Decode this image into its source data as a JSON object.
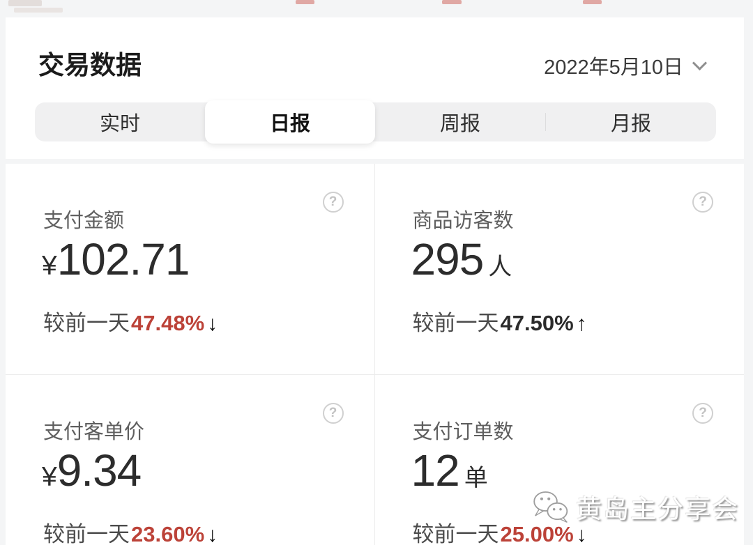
{
  "header": {
    "title": "交易数据",
    "date_label": "2022年5月10日"
  },
  "tabs": [
    {
      "label": "实时",
      "active": false
    },
    {
      "label": "日报",
      "active": true
    },
    {
      "label": "周报",
      "active": false
    },
    {
      "label": "月报",
      "active": false
    }
  ],
  "cards": [
    {
      "label": "支付金额",
      "currency": "¥",
      "value": "102.71",
      "unit": "",
      "delta_prefix": "较前一天",
      "delta_value": "47.48%",
      "delta_arrow": "↓",
      "delta_color": "#bc4238"
    },
    {
      "label": "商品访客数",
      "currency": "",
      "value": "295",
      "unit": "人",
      "delta_prefix": "较前一天",
      "delta_value": "47.50%",
      "delta_arrow": "↑",
      "delta_color": "#2b2b2b"
    },
    {
      "label": "支付客单价",
      "currency": "¥",
      "value": "9.34",
      "unit": "",
      "delta_prefix": "较前一天",
      "delta_value": "23.60%",
      "delta_arrow": "↓",
      "delta_color": "#bc4238"
    },
    {
      "label": "支付订单数",
      "currency": "",
      "value": "12",
      "unit": "单",
      "delta_prefix": "较前一天",
      "delta_value": "25.00%",
      "delta_arrow": "↓",
      "delta_color": "#bc4238"
    }
  ],
  "help_icon_glyph": "?",
  "watermark": {
    "text": "黄岛主分享会",
    "icon": "wechat-logo"
  },
  "colors": {
    "accent_red": "#bc4238",
    "page_bg": "#f4f5f6",
    "panel_bg": "#ffffff",
    "tabbar_bg": "#f0f0f1",
    "divider": "#ececec"
  }
}
